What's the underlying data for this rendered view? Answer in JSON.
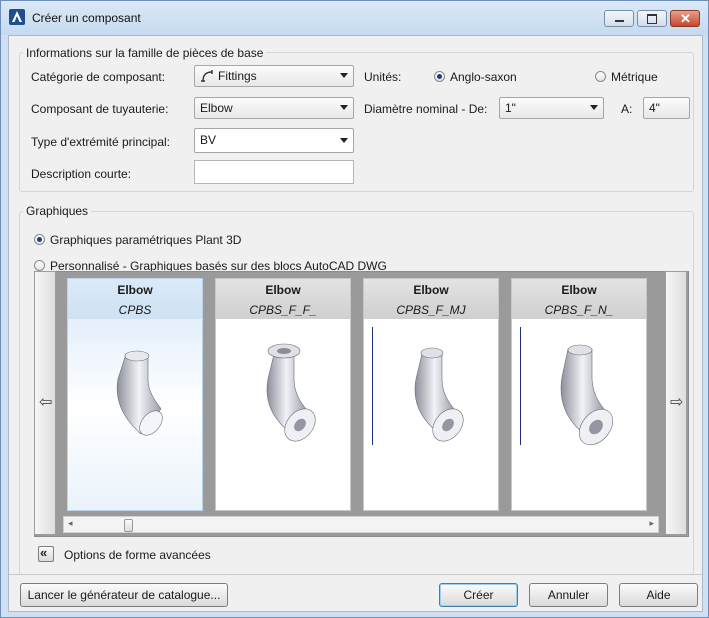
{
  "window": {
    "title": "Créer un composant"
  },
  "base_family": {
    "legend": "Informations sur la famille de pièces de base",
    "category_label": "Catégorie de composant:",
    "category_value": "Fittings",
    "units_label": "Unités:",
    "units_options": [
      "Anglo-saxon",
      "Métrique"
    ],
    "units_selected": "Anglo-saxon",
    "pipe_component_label": "Composant de tuyauterie:",
    "pipe_component_value": "Elbow",
    "nominal_diameter_label": "Diamètre nominal - De:",
    "nominal_from": "1\"",
    "to_label": "A:",
    "nominal_to": "4\"",
    "end_type_label": "Type d'extrémité principal:",
    "end_type_value": "BV",
    "short_description_label": "Description courte:",
    "short_description_value": ""
  },
  "graphics": {
    "legend": "Graphiques",
    "option_parametric": "Graphiques paramétriques Plant 3D",
    "option_custom": "Personnalisé - Graphiques basés sur des blocs AutoCAD DWG",
    "selected_option": "Graphiques paramétriques Plant 3D",
    "cards": [
      {
        "name": "Elbow",
        "code": "CPBS"
      },
      {
        "name": "Elbow",
        "code": "CPBS_F_F_"
      },
      {
        "name": "Elbow",
        "code": "CPBS_F_MJ"
      },
      {
        "name": "Elbow",
        "code": "CPBS_F_N_"
      }
    ],
    "selected_card": "CPBS",
    "advanced_options": "Options de forme avancées"
  },
  "footer": {
    "catalog_builder": "Lancer le générateur de catalogue...",
    "create": "Créer",
    "cancel": "Annuler",
    "help": "Aide"
  }
}
